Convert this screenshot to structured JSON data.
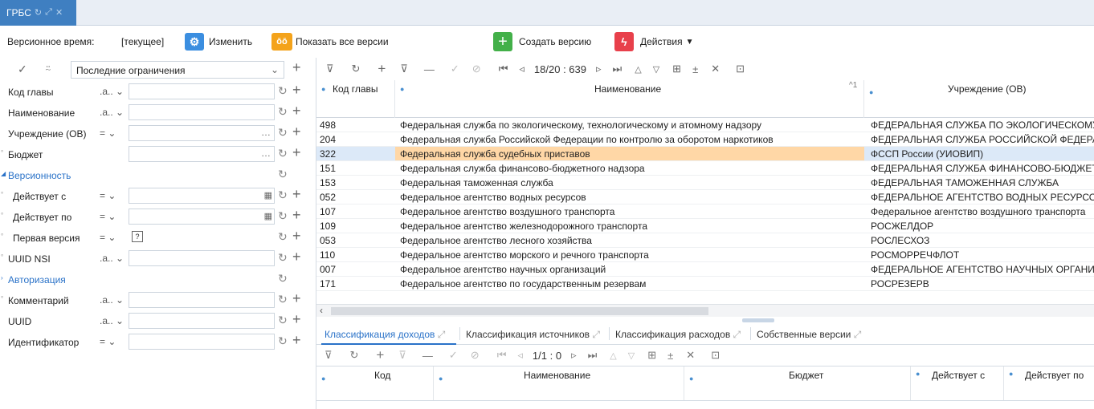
{
  "window": {
    "tab_title": "ГРБС"
  },
  "topbar": {
    "version_time_label": "Версионное время:",
    "version_time_value": "[текущее]",
    "change_label": "Изменить",
    "show_all_label": "Показать все версии",
    "create_label": "Создать версию",
    "actions_label": "Действия"
  },
  "filter": {
    "preset": "Последние ограничения",
    "rows": [
      {
        "label": "Код главы",
        "op": ".a.."
      },
      {
        "label": "Наименование",
        "op": ".a.."
      },
      {
        "label": "Учреждение (ОВ)",
        "op": "="
      },
      {
        "label": "Бюджет",
        "op": ""
      },
      {
        "label": "Версионность",
        "op": ""
      },
      {
        "label": "Действует с",
        "op": "="
      },
      {
        "label": "Действует по",
        "op": "="
      },
      {
        "label": "Первая версия",
        "op": "="
      },
      {
        "label": "UUID NSI",
        "op": ".a.."
      },
      {
        "label": "Авторизация",
        "op": ""
      },
      {
        "label": "Комментарий",
        "op": ".a.."
      },
      {
        "label": "UUID",
        "op": ".a.."
      },
      {
        "label": "Идентификатор",
        "op": "="
      }
    ]
  },
  "grid": {
    "counter": "18/20 : 639",
    "columns": [
      "Код главы",
      "Наименование",
      "Учреждение (ОВ)"
    ],
    "rows": [
      [
        "498",
        "Федеральная служба по экологическому, технологическому и атомному надзору",
        "ФЕДЕРАЛЬНАЯ СЛУЖБА ПО ЭКОЛОГИЧЕСКОМУ"
      ],
      [
        "204",
        "Федеральная служба Российской Федерации по контролю за оборотом наркотиков",
        "ФЕДЕРАЛЬНАЯ СЛУЖБА РОССИЙСКОЙ ФЕДЕРАЦ"
      ],
      [
        "322",
        "Федеральная служба судебных приставов",
        "ФССП России (УИОВИП)"
      ],
      [
        "151",
        "Федеральная служба финансово-бюджетного надзора",
        "ФЕДЕРАЛЬНАЯ СЛУЖБА ФИНАНСОВО-БЮДЖЕТН"
      ],
      [
        "153",
        "Федеральная таможенная служба",
        "ФЕДЕРАЛЬНАЯ ТАМОЖЕННАЯ СЛУЖБА"
      ],
      [
        "052",
        "Федеральное агентство водных ресурсов",
        "ФЕДЕРАЛЬНОЕ АГЕНТСТВО ВОДНЫХ РЕСУРСОВ"
      ],
      [
        "107",
        "Федеральное агентство воздушного транспорта",
        "Федеральное агентство воздушного транспорта"
      ],
      [
        "109",
        "Федеральное агентство железнодорожного транспорта",
        "РОСЖЕЛДОР"
      ],
      [
        "053",
        "Федеральное агентство лесного хозяйства",
        "РОСЛЕСХОЗ"
      ],
      [
        "110",
        "Федеральное агентство морского и речного транспорта",
        "РОСМОРРЕЧФЛОТ"
      ],
      [
        "007",
        "Федеральное агентство научных организаций",
        "ФЕДЕРАЛЬНОЕ АГЕНТСТВО НАУЧНЫХ ОРГАНИЗА"
      ],
      [
        "171",
        "Федеральное агентство по государственным резервам",
        "РОСРЕЗЕРВ"
      ]
    ]
  },
  "subtabs": [
    "Классификация доходов",
    "Классификация источников",
    "Классификация расходов",
    "Собственные версии"
  ],
  "subgrid": {
    "counter": "1/1 : 0",
    "columns": [
      "Код",
      "Наименование",
      "Бюджет",
      "Действует с",
      "Действует по"
    ]
  }
}
